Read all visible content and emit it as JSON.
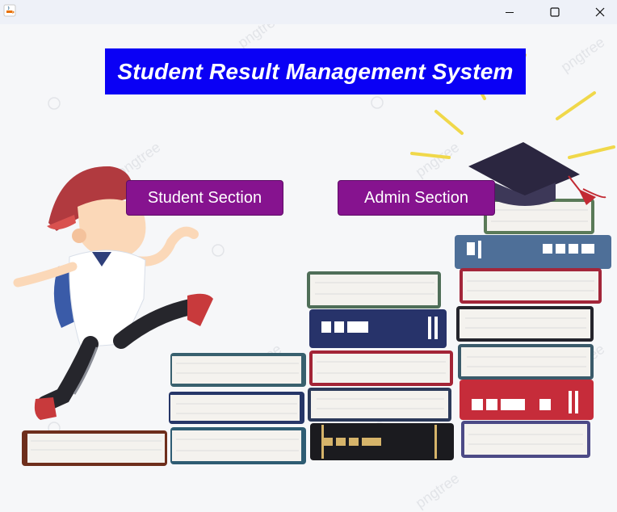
{
  "window": {
    "title": "",
    "controls": {
      "minimize": "minimize-icon",
      "maximize": "maximize-icon",
      "close": "close-icon"
    }
  },
  "banner": {
    "title": "Student Result Management System",
    "background": "#0a00f5",
    "text_color": "#ffffff"
  },
  "buttons": {
    "student": "Student Section",
    "admin": "Admin Section",
    "background": "#86138f"
  },
  "illustration": {
    "subject": "boy-running-up-book-stairs-to-graduation-cap",
    "watermark": "pngtree"
  }
}
